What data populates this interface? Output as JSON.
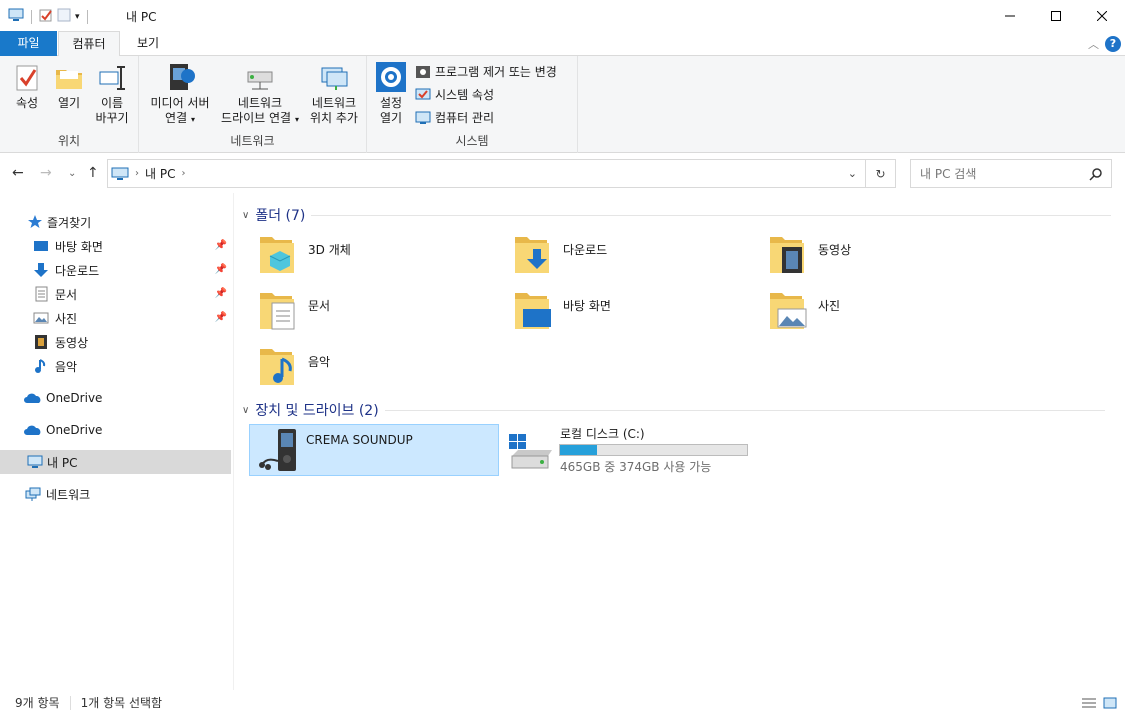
{
  "window": {
    "title": "내 PC",
    "minimize_icon": "minimize-icon",
    "maximize_icon": "maximize-icon",
    "close_icon": "close-icon"
  },
  "ribbon_tabs": {
    "file": "파일",
    "computer": "컴퓨터",
    "view": "보기"
  },
  "ribbon": {
    "location_group": {
      "label": "위치",
      "properties": "속성",
      "open": "열기",
      "rename_line1": "이름",
      "rename_line2": "바꾸기"
    },
    "network_group": {
      "label": "네트워크",
      "media_line1": "미디어 서버",
      "media_line2": "연결",
      "drive_line1": "네트워크",
      "drive_line2": "드라이브 연결",
      "location_line1": "네트워크",
      "location_line2": "위치 추가"
    },
    "system_group": {
      "label": "시스템",
      "settings_line1": "설정",
      "settings_line2": "열기",
      "uninstall": "프로그램 제거 또는 변경",
      "system_props": "시스템 속성",
      "manage": "컴퓨터 관리"
    }
  },
  "address": {
    "path": "내 PC",
    "search_placeholder": "내 PC 검색"
  },
  "sidebar": {
    "quick_access": "즐겨찾기",
    "items": [
      {
        "label": "바탕 화면",
        "icon": "desktop-icon"
      },
      {
        "label": "다운로드",
        "icon": "downloads-icon"
      },
      {
        "label": "문서",
        "icon": "documents-icon"
      },
      {
        "label": "사진",
        "icon": "pictures-icon"
      },
      {
        "label": "동영상",
        "icon": "videos-icon"
      },
      {
        "label": "음악",
        "icon": "music-icon"
      }
    ],
    "onedrive_1": "OneDrive",
    "onedrive_2": "OneDrive",
    "this_pc": "내 PC",
    "network": "네트워크"
  },
  "folders": {
    "heading": "폴더 (7)",
    "items": [
      {
        "label": "3D 개체"
      },
      {
        "label": "다운로드"
      },
      {
        "label": "동영상"
      },
      {
        "label": "문서"
      },
      {
        "label": "바탕 화면"
      },
      {
        "label": "사진"
      },
      {
        "label": "음악"
      }
    ]
  },
  "devices": {
    "heading": "장치 및 드라이브 (2)",
    "device": {
      "label": "CREMA SOUNDUP"
    },
    "drive": {
      "label": "로컬 디스크 (C:)",
      "space_text": "465GB 중 374GB 사용 가능",
      "used_fraction": 0.196
    }
  },
  "status": {
    "item_count": "9개 항목",
    "selected": "1개 항목 선택함"
  },
  "colors": {
    "accent": "#1979ca",
    "selection": "#cce8ff",
    "folder": "#f8d775",
    "heading": "#1e3287"
  }
}
